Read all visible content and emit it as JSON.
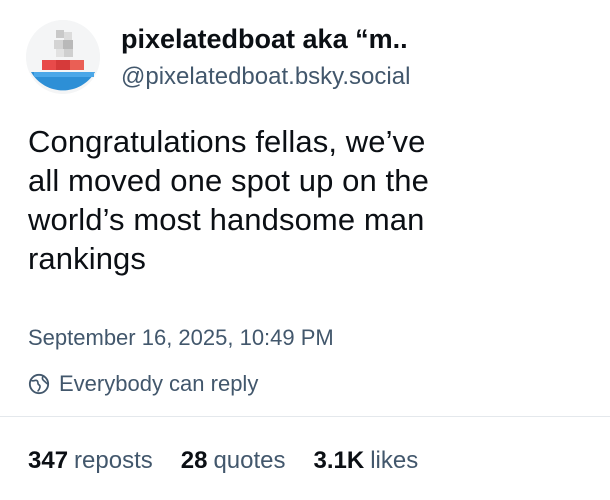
{
  "author": {
    "display_name": "pixelatedboat aka “m..",
    "handle": "@pixelatedboat.bsky.social"
  },
  "post": {
    "text_lines": [
      "Congratulations fellas, we’ve",
      "all moved one spot up on the",
      "world’s most handsome man",
      "rankings"
    ],
    "timestamp": "September 16, 2025, 10:49 PM",
    "reply_setting": "Everybody can reply",
    "reply_icon": "globe-icon"
  },
  "stats": [
    {
      "count": "347",
      "label": "reposts"
    },
    {
      "count": "28",
      "label": "quotes"
    },
    {
      "count": "3.1K",
      "label": "likes"
    }
  ],
  "colors": {
    "text": "#0b0f14",
    "secondary_text": "#42576c",
    "divider": "#e4e8ec"
  }
}
